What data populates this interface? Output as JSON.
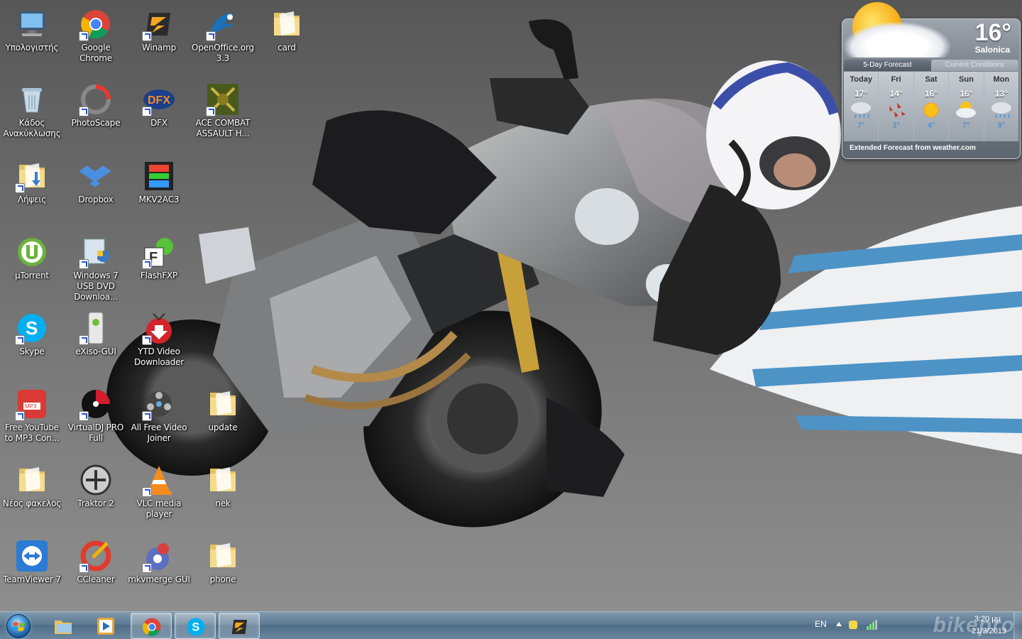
{
  "desktop": {
    "icons": [
      {
        "label": "Υπολογιστής",
        "icon": "computer-icon",
        "shortcut": false
      },
      {
        "label": "Google Chrome",
        "icon": "chrome-icon",
        "shortcut": true
      },
      {
        "label": "Winamp",
        "icon": "winamp-icon",
        "shortcut": true
      },
      {
        "label": "OpenOffice.org 3.3",
        "icon": "openoffice-icon",
        "shortcut": true
      },
      {
        "label": "card",
        "icon": "folder-icon",
        "shortcut": false
      },
      {
        "label": "Κάδος Ανακύκλωσης",
        "icon": "recycle-bin-icon",
        "shortcut": false
      },
      {
        "label": "PhotoScape",
        "icon": "photoscape-icon",
        "shortcut": true
      },
      {
        "label": "DFX",
        "icon": "dfx-icon",
        "shortcut": true
      },
      {
        "label": "ACE COMBAT ASSAULT H...",
        "icon": "game-icon",
        "shortcut": true
      },
      {
        "label": "Λήψεις",
        "icon": "downloads-folder-icon",
        "shortcut": true
      },
      {
        "label": "Dropbox",
        "icon": "dropbox-icon",
        "shortcut": false
      },
      {
        "label": "MKV2AC3",
        "icon": "film-icon",
        "shortcut": false
      },
      {
        "label": "µTorrent",
        "icon": "utorrent-icon",
        "shortcut": false
      },
      {
        "label": "Windows 7 USB DVD Downloa...",
        "icon": "installer-icon",
        "shortcut": true
      },
      {
        "label": "FlashFXP",
        "icon": "flashfxp-icon",
        "shortcut": true
      },
      {
        "label": "Skype",
        "icon": "skype-icon",
        "shortcut": true
      },
      {
        "label": "eXiso-GUI",
        "icon": "xbox-icon",
        "shortcut": true
      },
      {
        "label": "YTD Video Downloader",
        "icon": "ytd-icon",
        "shortcut": true
      },
      {
        "label": "Free YouTube to MP3 Con...",
        "icon": "mp3-icon",
        "shortcut": true
      },
      {
        "label": "VirtualDJ PRO Full",
        "icon": "virtualdj-icon",
        "shortcut": true
      },
      {
        "label": "All Free Video Joiner",
        "icon": "video-joiner-icon",
        "shortcut": true
      },
      {
        "label": "update",
        "icon": "folder-icon",
        "shortcut": false
      },
      {
        "label": "Νέος φακελος",
        "icon": "folder-icon",
        "shortcut": false
      },
      {
        "label": "Traktor 2",
        "icon": "traktor-icon",
        "shortcut": false
      },
      {
        "label": "VLC media player",
        "icon": "vlc-icon",
        "shortcut": true
      },
      {
        "label": "nek",
        "icon": "folder-icon",
        "shortcut": false
      },
      {
        "label": "TeamViewer 7",
        "icon": "teamviewer-icon",
        "shortcut": false
      },
      {
        "label": "CCleaner",
        "icon": "ccleaner-icon",
        "shortcut": true
      },
      {
        "label": "mkvmerge GUI",
        "icon": "mkvmerge-icon",
        "shortcut": true
      },
      {
        "label": "phone",
        "icon": "folder-icon",
        "shortcut": false
      }
    ]
  },
  "weather": {
    "temperature": "16°",
    "city": "Salonica",
    "tabs": [
      "5-Day Forecast",
      "Current Conditions"
    ],
    "days": [
      {
        "name": "Today",
        "high": "17°",
        "low": "7°",
        "condition": "rain-icon"
      },
      {
        "name": "Fri",
        "high": "14°",
        "low": "3°",
        "condition": "wind-leaves-icon"
      },
      {
        "name": "Sat",
        "high": "16°",
        "low": "4°",
        "condition": "sun-icon"
      },
      {
        "name": "Sun",
        "high": "16°",
        "low": "7°",
        "condition": "partly-cloudy-icon"
      },
      {
        "name": "Mon",
        "high": "13°",
        "low": "9°",
        "condition": "rain-icon"
      }
    ],
    "extended": "Extended Forecast from weather.com"
  },
  "taskbar": {
    "pinned": [
      "explorer-icon",
      "media-player-icon",
      "chrome-icon",
      "skype-icon",
      "winamp-icon"
    ],
    "tray": {
      "language": "EN",
      "time": "3:20 μμ",
      "date": "21/3/2013",
      "watermark": "bikepro"
    }
  },
  "colors": {
    "taskbar": "#5c7a93",
    "accent_blue": "#2a5ad8",
    "folder": "#f1d27a"
  }
}
